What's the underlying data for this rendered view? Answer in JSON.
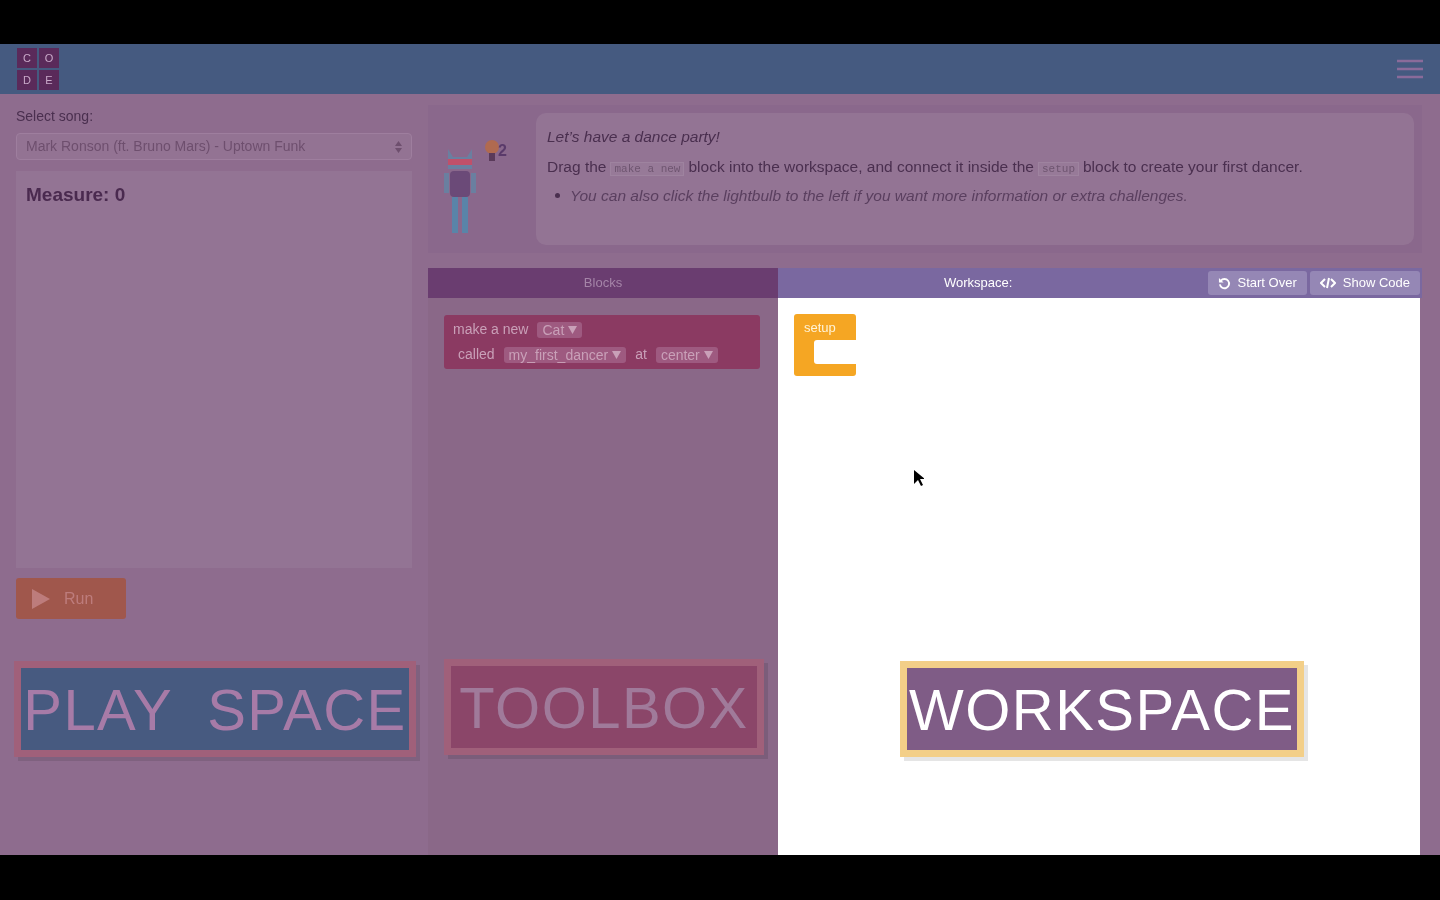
{
  "header": {
    "logo_letters": [
      "C",
      "O",
      "D",
      "E"
    ]
  },
  "song": {
    "label": "Select song:",
    "value": "Mark Ronson (ft. Bruno Mars) - Uptown Funk"
  },
  "measure": "Measure: 0",
  "run_button": "Run",
  "instructions": {
    "hint_count": "2",
    "title": "Let’s have a dance party!",
    "body": [
      {
        "kind": "text",
        "text": "Drag the"
      },
      {
        "kind": "code",
        "text": "make a new"
      },
      {
        "kind": "text",
        "text": "block into the workspace, and connect it inside the"
      },
      {
        "kind": "code",
        "text": "setup"
      },
      {
        "kind": "text",
        "text": "block to create your first dancer."
      }
    ],
    "bullets": [
      "You can also click the lightbulb to the left if you want more information or extra challenges."
    ]
  },
  "toolbox": {
    "title": "Blocks",
    "block": {
      "line1": [
        {
          "kind": "text",
          "text": "make a new"
        },
        {
          "kind": "dropdown",
          "text": "Cat"
        }
      ],
      "line2": [
        {
          "kind": "text",
          "text": "called"
        },
        {
          "kind": "dropdown",
          "text": "my_first_dancer"
        },
        {
          "kind": "text",
          "text": "at"
        },
        {
          "kind": "dropdown",
          "text": "center"
        }
      ]
    }
  },
  "workspace": {
    "title": "Workspace:",
    "buttons": [
      {
        "kind": "reset",
        "label": "Start Over"
      },
      {
        "kind": "code",
        "label": "Show Code"
      }
    ],
    "setup_block": "setup"
  },
  "overlay_labels": [
    {
      "kind": "play",
      "text": "PLAY  SPACE"
    },
    {
      "kind": "toolbox",
      "text": "TOOLBOX"
    },
    {
      "kind": "workspace",
      "text": "WORKSPACE"
    }
  ]
}
